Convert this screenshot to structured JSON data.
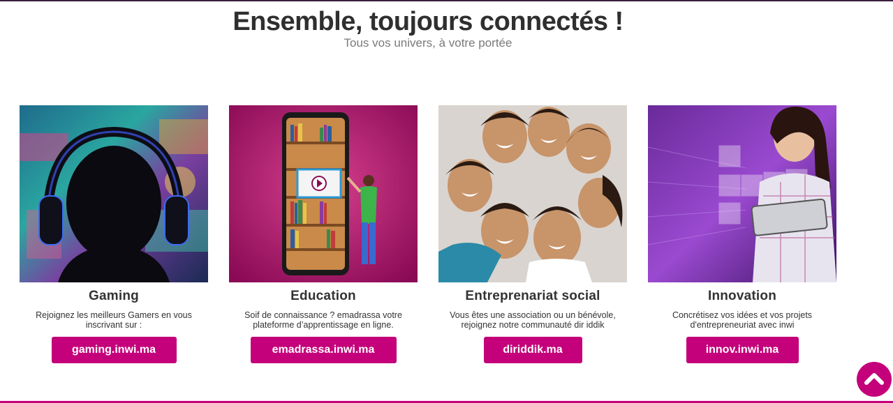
{
  "header": {
    "title": "Ensemble, toujours connectés !",
    "subtitle": "Tous vos univers, à votre portée"
  },
  "cards": [
    {
      "title": "Gaming",
      "description": "Rejoignez les meilleurs Gamers en vous inscrivant sur :",
      "button_label": "gaming.inwi.ma",
      "image": "gamer-headphones-photo"
    },
    {
      "title": "Education",
      "description": "Soif de connaissance ? emadrassa votre plateforme d’apprentissage en ligne.",
      "button_label": "emadrassa.inwi.ma",
      "image": "phone-bookshelf-photo"
    },
    {
      "title": "Entreprenariat social",
      "description": "Vous êtes une association ou un bénévole, rejoignez notre communauté dir iddik",
      "button_label": "diriddik.ma",
      "image": "group-smiling-people-photo"
    },
    {
      "title": "Innovation",
      "description": "Concrétisez vos idées et vos projets d'entrepreneuriat avec inwi",
      "button_label": "innov.inwi.ma",
      "image": "woman-tablet-photo"
    }
  ],
  "scroll_top": {
    "icon": "chevron-up-icon"
  },
  "colors": {
    "accent": "#c4007a",
    "title": "#2f2f2f",
    "subtitle": "#7a7a7a"
  }
}
